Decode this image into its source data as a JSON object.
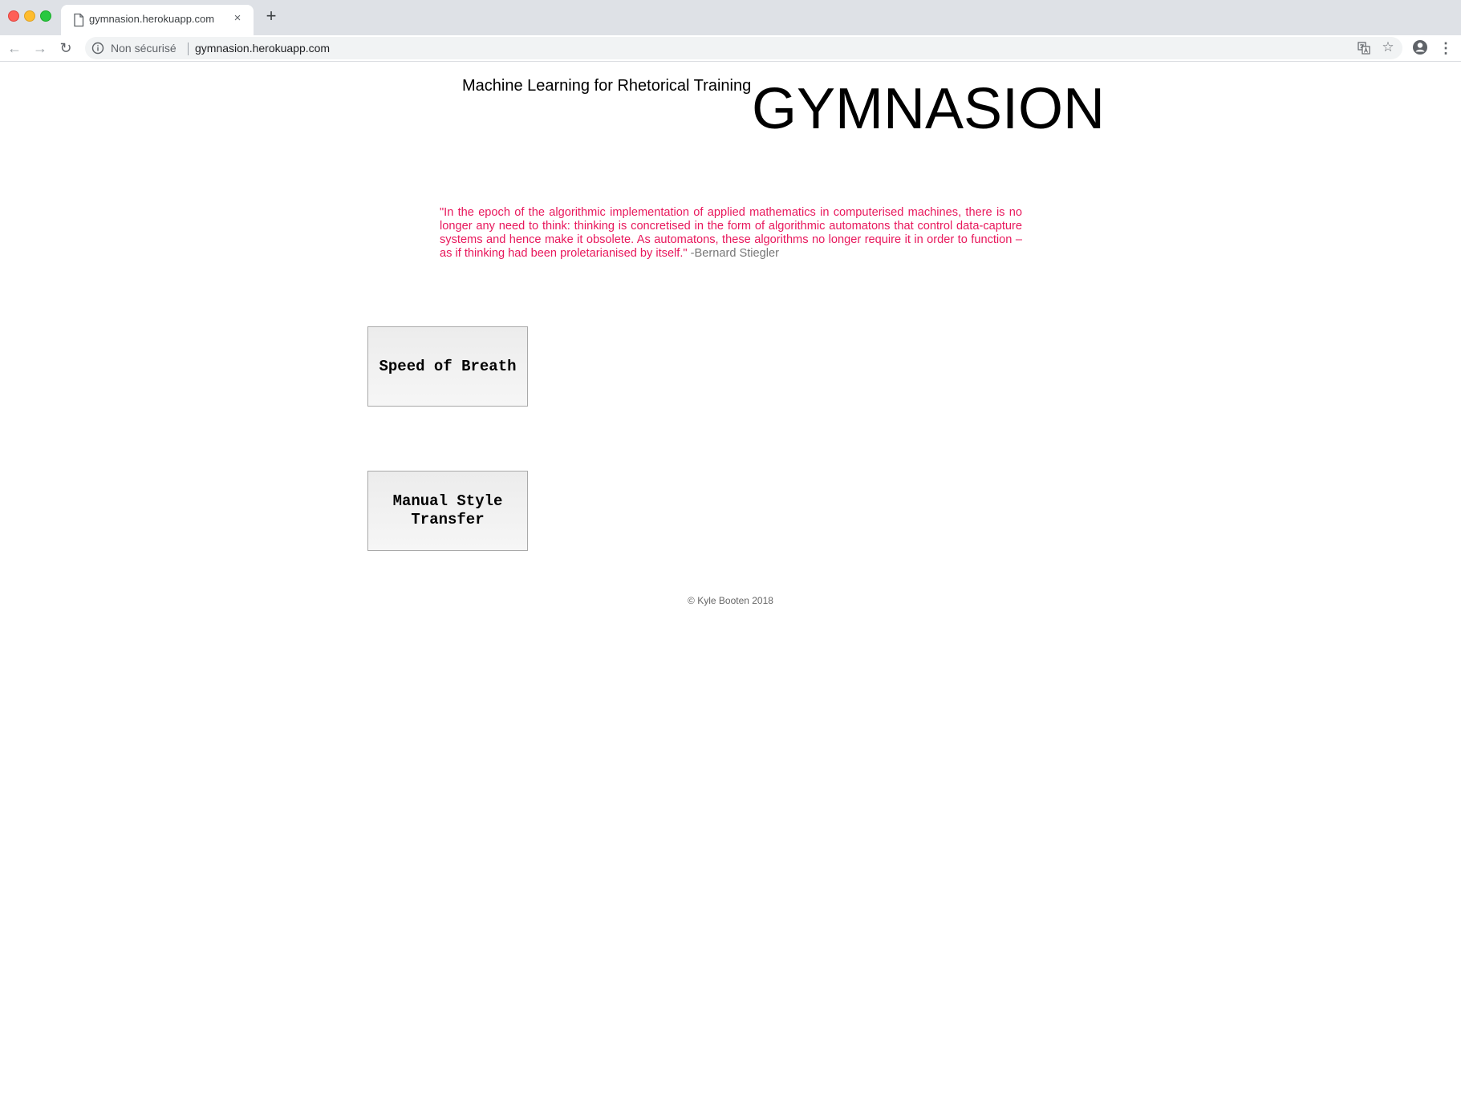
{
  "browser": {
    "tab_title": "gymnasion.herokuapp.com",
    "close_glyph": "×",
    "new_tab_glyph": "+",
    "back_glyph": "←",
    "forward_glyph": "→",
    "reload_glyph": "↻",
    "security_label": "Non sécurisé",
    "url": "gymnasion.herokuapp.com",
    "star_glyph": "☆",
    "menu_glyph": "⋮"
  },
  "page": {
    "subtitle": "Machine Learning for Rhetorical Training",
    "title": "GYMNASION",
    "quote": {
      "text": "\"In the epoch of the algorithmic implementation of applied mathematics in computerised machines, there is no longer any need to think: thinking is concretised in the form of algorithmic automatons that control data-capture systems and hence make it obsolete. As automatons, these algorithms no longer require it in order to function – as if thinking had been proletarianised by itself.\"",
      "author": "-Bernard Stiegler"
    },
    "buttons": {
      "speed_of_breath": "Speed of Breath",
      "manual_style_transfer": "Manual Style Transfer"
    },
    "footer": "© Kyle Booten 2018"
  }
}
